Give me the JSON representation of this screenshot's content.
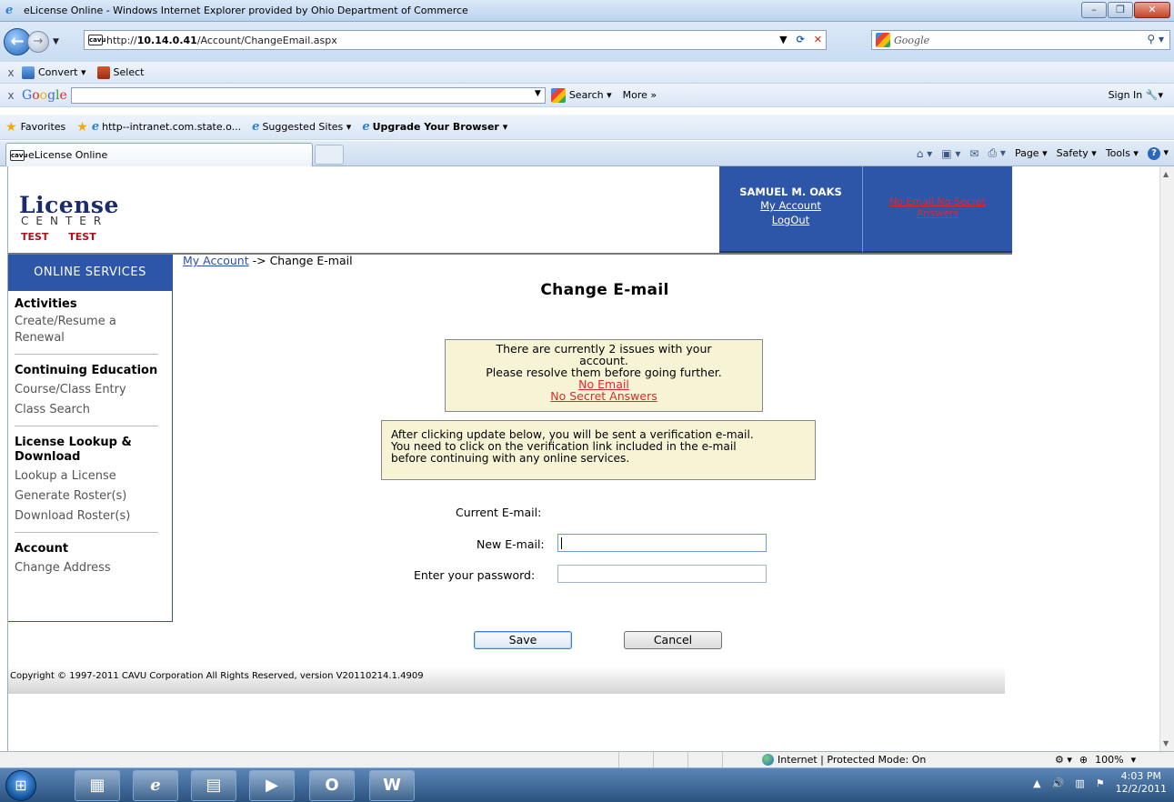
{
  "window": {
    "title": "eLicense Online - Windows Internet Explorer provided by Ohio Department of Commerce",
    "controls": [
      "–",
      "❐",
      "✕"
    ]
  },
  "address": {
    "url_prefix": "http://",
    "url_host": "10.14.0.41",
    "url_path": "/Account/ChangeEmail.aspx",
    "search_placeholder": "Google"
  },
  "toolbar1": {
    "convert": "Convert",
    "select": "Select"
  },
  "toolbar2": {
    "google": "Google",
    "search": "Search",
    "more": "More »",
    "signin": "Sign In"
  },
  "favorites": {
    "label": "Favorites",
    "items": [
      "http--intranet.com.state.o...",
      "Suggested Sites",
      "Upgrade Your Browser"
    ]
  },
  "tab": {
    "label": "eLicense Online"
  },
  "commandbar": {
    "page": "Page",
    "safety": "Safety",
    "tools": "Tools"
  },
  "header": {
    "logo_main": "License",
    "logo_center": "CENTER",
    "logo_test": "TEST TEST",
    "user_name": "SAMUEL M. OAKS",
    "my_account": "My Account",
    "logout": "LogOut",
    "issues_link": "No Email No Secret Answers"
  },
  "sidebar": {
    "heading": "ONLINE SERVICES",
    "sections": [
      {
        "title": "Activities",
        "links": [
          "Create/Resume a Renewal"
        ]
      },
      {
        "title": "Continuing Education",
        "links": [
          "Course/Class Entry",
          "Class Search"
        ]
      },
      {
        "title": "License Lookup & Download",
        "links": [
          "Lookup a License",
          "Generate Roster(s)",
          "Download Roster(s)"
        ]
      },
      {
        "title": "Account",
        "links": [
          "Change Address"
        ]
      }
    ]
  },
  "breadcrumb": {
    "link": "My Account",
    "current": " -> Change E-mail"
  },
  "main": {
    "title": "Change E-mail",
    "issues_line1": "There are currently 2 issues with your",
    "issues_line2": "account.",
    "issues_line3": "Please resolve them before going further.",
    "issue_links": [
      "No Email",
      "No Secret Answers"
    ],
    "verify_line1": "After clicking update below, you will be sent a verification e-mail.",
    "verify_line2": "You need to click on the verification link included in the e-mail",
    "verify_line3": "before continuing with any online services.",
    "current_email_label": "Current E-mail:",
    "current_email_value": "",
    "new_email_label": "New E-mail:",
    "new_email_value": "",
    "password_label": "Enter your password:",
    "password_value": "",
    "save": "Save",
    "cancel": "Cancel"
  },
  "footer": {
    "text": "Copyright © 1997-2011 CAVU Corporation All Rights Reserved, version V20110214.1.4909"
  },
  "statusbar": {
    "zone": "Internet | Protected Mode: On",
    "zoom": "100%"
  },
  "taskbar": {
    "time": "4:03 PM",
    "date": "12/2/2011"
  }
}
